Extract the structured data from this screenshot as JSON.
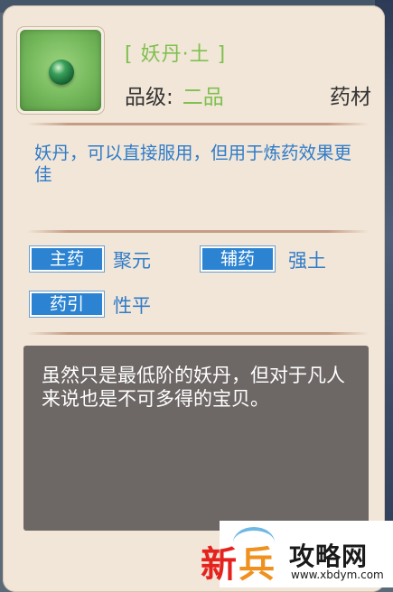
{
  "item": {
    "name": "[ 妖丹·土 ]",
    "grade_label": "品级:",
    "grade_value": "二品",
    "type": "药材",
    "icon": "green-orb-icon"
  },
  "description": "妖丹，可以直接服用，但用于炼药效果更佳",
  "attributes": [
    {
      "tag": "主药",
      "value": "聚元"
    },
    {
      "tag": "辅药",
      "value": "强土"
    },
    {
      "tag": "药引",
      "value": "性平"
    }
  ],
  "lore": "虽然只是最低阶的妖丹，但对于凡人来说也是不可多得的宝贝。",
  "watermark": {
    "char1": "新",
    "char2": "兵",
    "site": "攻略网",
    "url": "www.xbdym.com"
  },
  "colors": {
    "panel_bg": "#f2e6d8",
    "name_green": "#7fc04f",
    "text_blue": "#2f7cc9",
    "tag_blue": "#2b83d1",
    "lore_bg": "#6d6766"
  }
}
